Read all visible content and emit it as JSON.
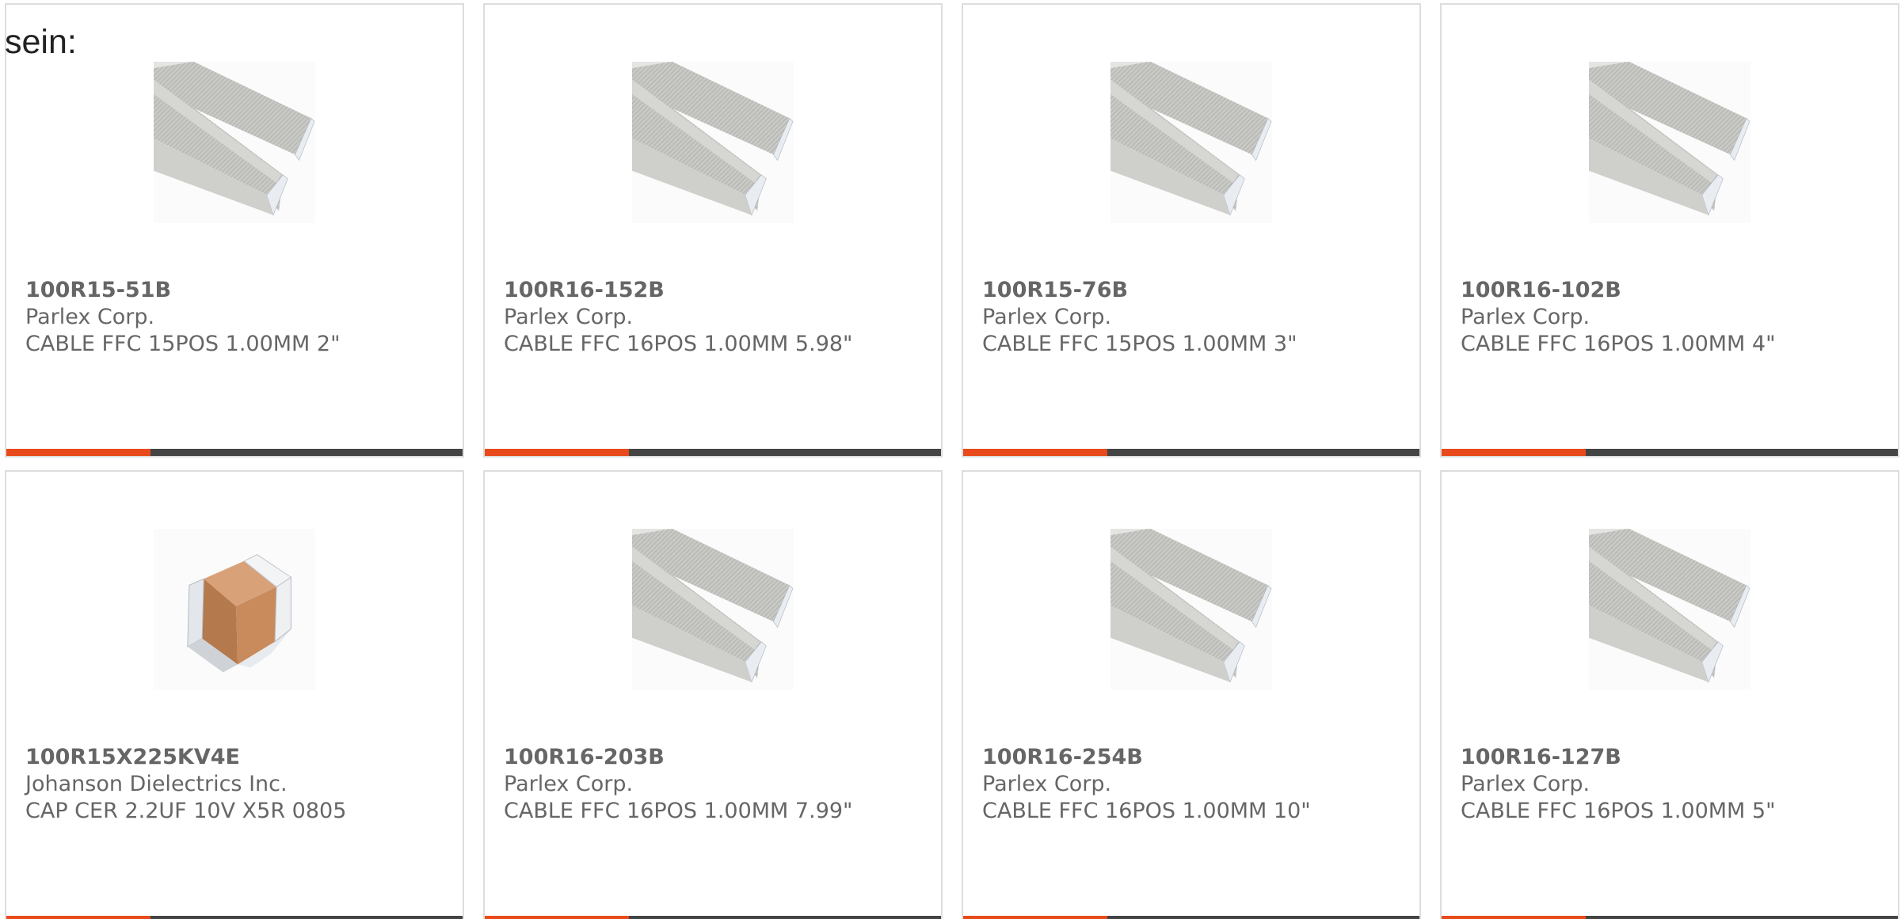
{
  "intro_text": "sein:",
  "accent_color": "#e84a1b",
  "bar_color": "#444444",
  "products": [
    {
      "part_number": "100R15-51B",
      "manufacturer": "Parlex Corp.",
      "description": "CABLE FFC 15POS 1.00MM 2\"",
      "image": "ffc-cable-image"
    },
    {
      "part_number": "100R16-152B",
      "manufacturer": "Parlex Corp.",
      "description": "CABLE FFC 16POS 1.00MM 5.98\"",
      "image": "ffc-cable-image"
    },
    {
      "part_number": "100R15-76B",
      "manufacturer": "Parlex Corp.",
      "description": "CABLE FFC 15POS 1.00MM 3\"",
      "image": "ffc-cable-image"
    },
    {
      "part_number": "100R16-102B",
      "manufacturer": "Parlex Corp.",
      "description": "CABLE FFC 16POS 1.00MM 4\"",
      "image": "ffc-cable-image"
    },
    {
      "part_number": "100R15X225KV4E",
      "manufacturer": "Johanson Dielectrics Inc.",
      "description": "CAP CER 2.2UF 10V X5R 0805",
      "image": "ceramic-capacitor-image"
    },
    {
      "part_number": "100R16-203B",
      "manufacturer": "Parlex Corp.",
      "description": "CABLE FFC 16POS 1.00MM 7.99\"",
      "image": "ffc-cable-image"
    },
    {
      "part_number": "100R16-254B",
      "manufacturer": "Parlex Corp.",
      "description": "CABLE FFC 16POS 1.00MM 10\"",
      "image": "ffc-cable-image"
    },
    {
      "part_number": "100R16-127B",
      "manufacturer": "Parlex Corp.",
      "description": "CABLE FFC 16POS 1.00MM 5\"",
      "image": "ffc-cable-image"
    }
  ]
}
